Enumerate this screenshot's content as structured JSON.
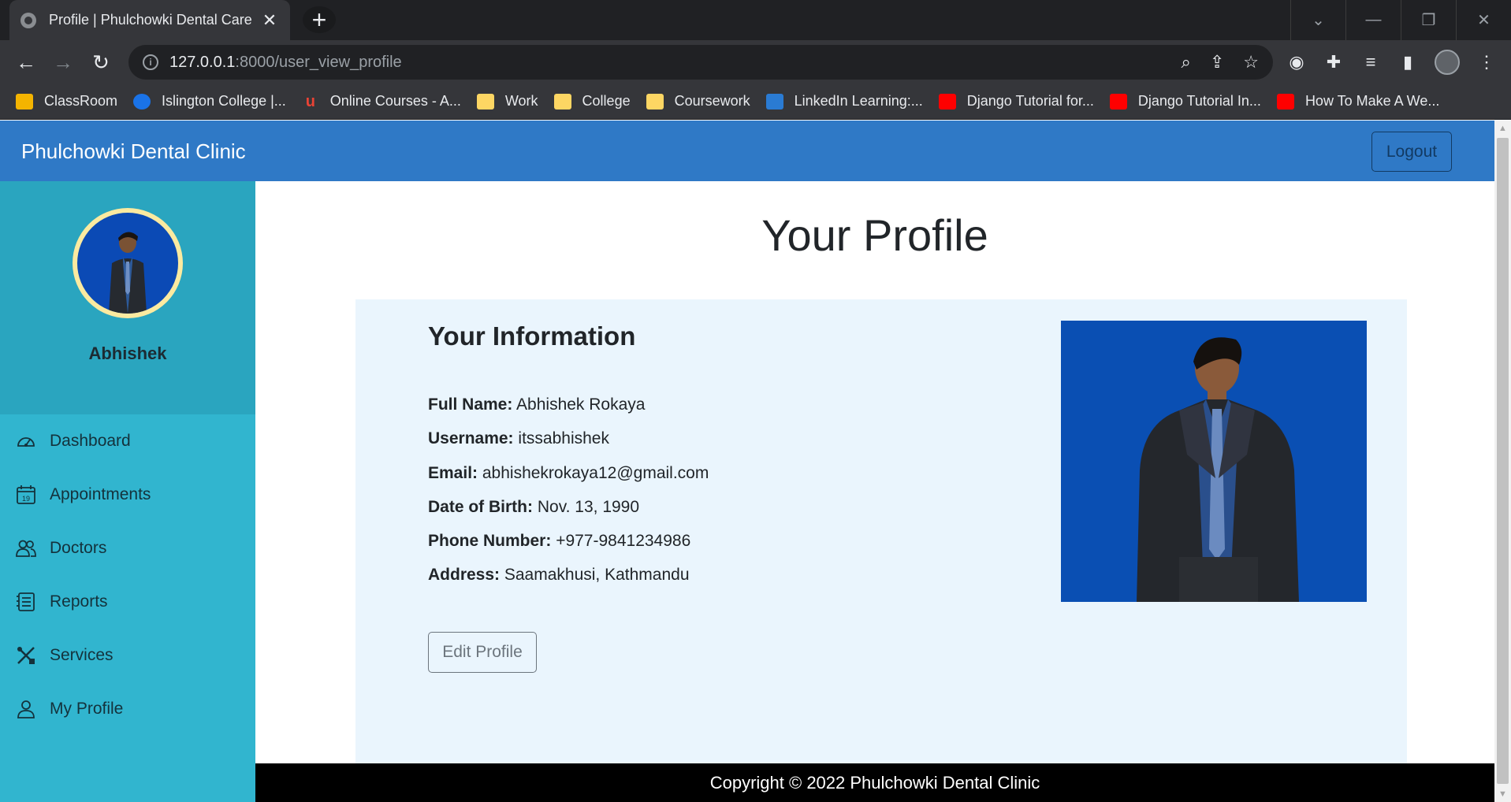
{
  "browser": {
    "tab_title": "Profile | Phulchowki Dental Care",
    "tab_close": "✕",
    "new_tab": "+",
    "url_host": "127.0.0.1",
    "url_path": ":8000/user_view_profile",
    "bookmarks": [
      {
        "label": "ClassRoom",
        "icon": "classroom-icon"
      },
      {
        "label": "Islington College |...",
        "icon": "islington-icon"
      },
      {
        "label": "Online Courses - A...",
        "icon": "udemy-icon"
      },
      {
        "label": "Work",
        "icon": "folder-icon"
      },
      {
        "label": "College",
        "icon": "folder-icon"
      },
      {
        "label": "Coursework",
        "icon": "folder-icon"
      },
      {
        "label": "LinkedIn Learning:...",
        "icon": "linkedin-icon"
      },
      {
        "label": "Django Tutorial for...",
        "icon": "youtube-icon"
      },
      {
        "label": "Django Tutorial In...",
        "icon": "youtube-icon"
      },
      {
        "label": "How To Make A We...",
        "icon": "youtube-icon"
      }
    ]
  },
  "navbar": {
    "brand": "Phulchowki Dental Clinic",
    "logout_label": "Logout"
  },
  "sidebar": {
    "user_name": "Abhishek",
    "items": [
      {
        "label": "Dashboard",
        "icon": "dashboard-icon"
      },
      {
        "label": "Appointments",
        "icon": "calendar-icon"
      },
      {
        "label": "Doctors",
        "icon": "doctors-icon"
      },
      {
        "label": "Reports",
        "icon": "reports-icon"
      },
      {
        "label": "Services",
        "icon": "services-icon"
      },
      {
        "label": "My Profile",
        "icon": "user-icon"
      }
    ],
    "calendar_day": "19"
  },
  "main": {
    "title": "Your Profile",
    "card_heading": "Your Information",
    "fields": [
      {
        "label": "Full Name:",
        "value": "Abhishek Rokaya"
      },
      {
        "label": "Username:",
        "value": "itssabhishek"
      },
      {
        "label": "Email:",
        "value": "abhishekrokaya12@gmail.com"
      },
      {
        "label": "Date of Birth:",
        "value": "Nov. 13, 1990"
      },
      {
        "label": "Phone Number:",
        "value": "+977-9841234986"
      },
      {
        "label": "Address:",
        "value": "Saamakhusi, Kathmandu"
      }
    ],
    "edit_label": "Edit Profile"
  },
  "footer": {
    "text": "Copyright © 2022 Phulchowki Dental Clinic"
  },
  "colors": {
    "navbar": "#2f79c6",
    "sidebar": "#31b5cf",
    "sidebar_top": "#2aa5bf",
    "card": "#eaf5fd",
    "photo_bg": "#0a4fb3"
  }
}
